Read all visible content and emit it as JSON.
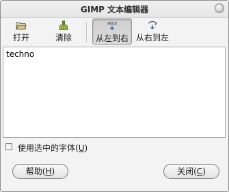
{
  "window": {
    "title": "GIMP 文本编辑器"
  },
  "toolbar": {
    "open": {
      "label": "打开",
      "icon": "folder-open-icon"
    },
    "clear": {
      "label": "清除",
      "icon": "clear-broom-icon"
    },
    "ltr": {
      "label": "从左到右",
      "icon": "text-ltr-icon",
      "icon_text": "ABCD",
      "active": true
    },
    "rtl": {
      "label": "从右到左",
      "icon": "text-rtl-icon",
      "icon_text": "DCBA",
      "active": false
    }
  },
  "editor": {
    "text": "techno"
  },
  "use_selected_font": {
    "label_prefix": "使用选中的字体(",
    "mnemonic": "U",
    "label_suffix": ")",
    "checked": false
  },
  "buttons": {
    "help": {
      "prefix": "帮助(",
      "mnemonic": "H",
      "suffix": ")"
    },
    "close": {
      "prefix": "关闭(",
      "mnemonic": "C",
      "suffix": ")"
    }
  }
}
